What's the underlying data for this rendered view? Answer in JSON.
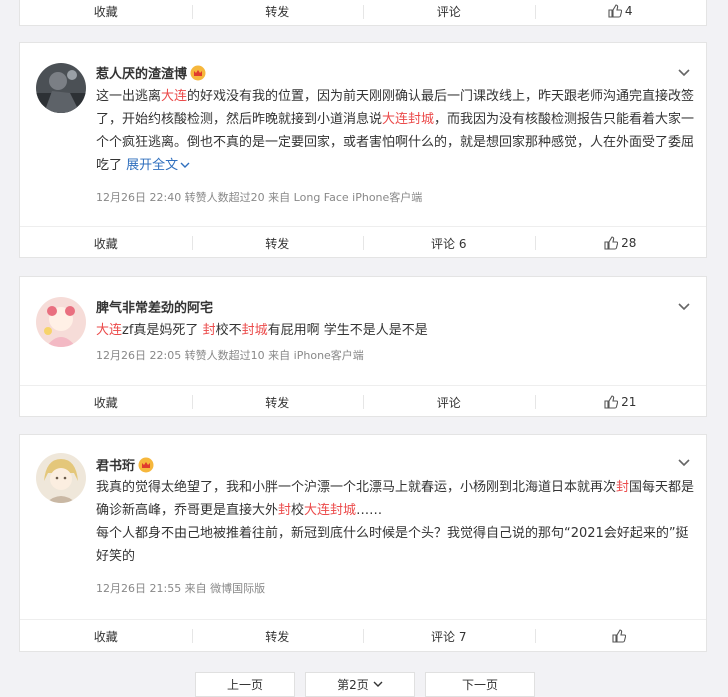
{
  "top_actions": {
    "collect": "收藏",
    "repost": "转发",
    "comment": "评论",
    "likes": "4"
  },
  "posts": [
    {
      "user": "惹人厌的渣渣博",
      "content": [
        {
          "t": "这一出逃离",
          "h": false
        },
        {
          "t": "大连",
          "h": true
        },
        {
          "t": "的好戏没有我的位置，因为前天刚刚确认最后一门课改线上，昨天跟老师沟通完直接改签了，开始约核酸检测，然后昨晚就接到小道消息说",
          "h": false
        },
        {
          "t": "大连封城",
          "h": true
        },
        {
          "t": "，而我因为没有核酸检测报告只能看着大家一个个疯狂逃离。倒也不真的是一定要回家，或者害怕啊什么的，就是想回家那种感觉，人在外面受了委屈吃了",
          "h": false
        }
      ],
      "expand": "展开全文",
      "meta": "12月26日 22:40 转赞人数超过20   来自 Long Face iPhone客户端",
      "actions": {
        "collect": "收藏",
        "repost": "转发",
        "comment": "评论 6",
        "likes": "28"
      }
    },
    {
      "user": "脾气非常差劲的阿宅",
      "content": [
        {
          "t": "大连",
          "h": true
        },
        {
          "t": "zf真是妈死了 ",
          "h": false
        },
        {
          "t": "封",
          "h": true
        },
        {
          "t": "校不",
          "h": false
        },
        {
          "t": "封城",
          "h": true
        },
        {
          "t": "有屁用啊 学生不是人是不是",
          "h": false
        }
      ],
      "meta": "12月26日 22:05 转赞人数超过10   来自 iPhone客户端",
      "actions": {
        "collect": "收藏",
        "repost": "转发",
        "comment": "评论",
        "likes": "21"
      }
    },
    {
      "user": "君书珩",
      "content": [
        {
          "t": "我真的觉得太绝望了，我和小胖一个沪漂一个北漂马上就春运，小杨刚到北海道日本就再次",
          "h": false
        },
        {
          "t": "封",
          "h": true
        },
        {
          "t": "国每天都是确诊新高峰，乔哥更是直接大外",
          "h": false
        },
        {
          "t": "封",
          "h": true
        },
        {
          "t": "校",
          "h": false
        },
        {
          "t": "大连封城",
          "h": true
        },
        {
          "t": "……",
          "h": false
        }
      ],
      "content2": "每个人都身不由己地被推着往前，新冠到底什么时候是个头？我觉得自己说的那句“2021会好起来的”挺好笑的",
      "meta": "12月26日 21:55  来自 微博国际版",
      "actions": {
        "collect": "收藏",
        "repost": "转发",
        "comment": "评论 7",
        "likes": ""
      }
    }
  ],
  "pager": {
    "prev": "上一页",
    "current": "第2页",
    "next": "下一页"
  }
}
